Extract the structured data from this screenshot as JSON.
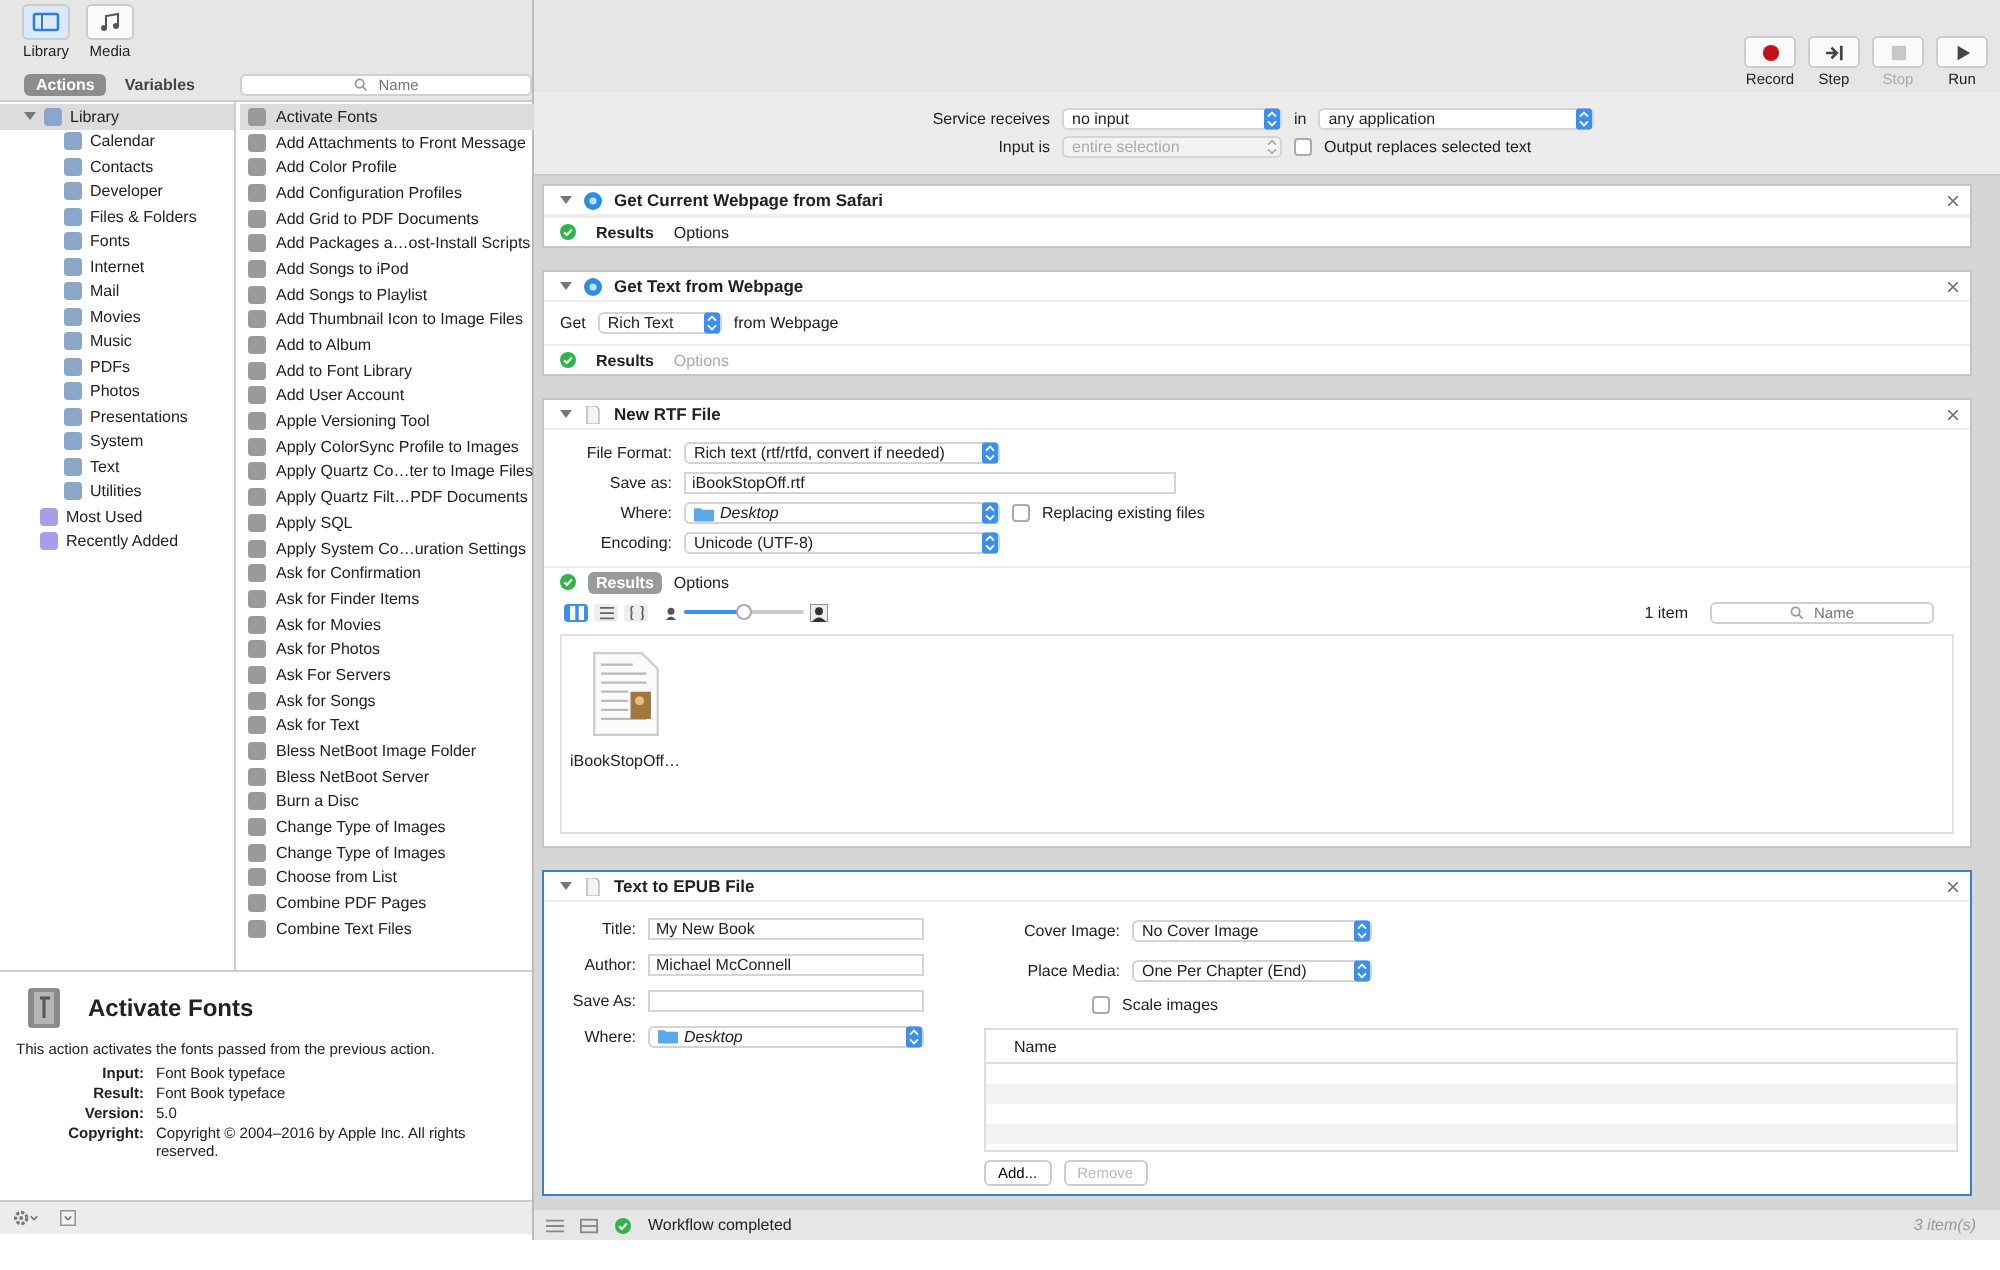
{
  "toolbar_left": [
    {
      "label": "Library",
      "kind": "library",
      "selected": true
    },
    {
      "label": "Media",
      "kind": "media",
      "selected": false
    }
  ],
  "toolbar_right": [
    {
      "label": "Record",
      "kind": "record",
      "disabled": false
    },
    {
      "label": "Step",
      "kind": "step",
      "disabled": false
    },
    {
      "label": "Stop",
      "kind": "stop",
      "disabled": true
    },
    {
      "label": "Run",
      "kind": "run",
      "disabled": false
    }
  ],
  "tabs": [
    {
      "label": "Actions",
      "selected": true
    },
    {
      "label": "Variables",
      "selected": false
    }
  ],
  "search": {
    "placeholder": "Name"
  },
  "library_tree": [
    {
      "label": "Library",
      "expanded": true,
      "selected": true,
      "children": [
        {
          "label": "Calendar",
          "selected": false
        },
        {
          "label": "Contacts",
          "selected": false
        },
        {
          "label": "Developer",
          "selected": false
        },
        {
          "label": "Files & Folders",
          "selected": false
        },
        {
          "label": "Fonts",
          "selected": false
        },
        {
          "label": "Internet",
          "selected": false
        },
        {
          "label": "Mail",
          "selected": false
        },
        {
          "label": "Movies",
          "selected": false
        },
        {
          "label": "Music",
          "selected": false
        },
        {
          "label": "PDFs",
          "selected": false
        },
        {
          "label": "Photos",
          "selected": false
        },
        {
          "label": "Presentations",
          "selected": false
        },
        {
          "label": "System",
          "selected": false
        },
        {
          "label": "Text",
          "selected": false
        },
        {
          "label": "Utilities",
          "selected": false
        }
      ]
    },
    {
      "label": "Most Used",
      "selected": false
    },
    {
      "label": "Recently Added",
      "selected": false
    }
  ],
  "action_list": [
    {
      "label": "Activate Fonts",
      "selected": true
    },
    {
      "label": "Add Attachments to Front Message",
      "selected": false
    },
    {
      "label": "Add Color Profile",
      "selected": false
    },
    {
      "label": "Add Configuration Profiles",
      "selected": false
    },
    {
      "label": "Add Grid to PDF Documents",
      "selected": false
    },
    {
      "label": "Add Packages a…ost-Install Scripts",
      "selected": false
    },
    {
      "label": "Add Songs to iPod",
      "selected": false
    },
    {
      "label": "Add Songs to Playlist",
      "selected": false
    },
    {
      "label": "Add Thumbnail Icon to Image Files",
      "selected": false
    },
    {
      "label": "Add to Album",
      "selected": false
    },
    {
      "label": "Add to Font Library",
      "selected": false
    },
    {
      "label": "Add User Account",
      "selected": false
    },
    {
      "label": "Apple Versioning Tool",
      "selected": false
    },
    {
      "label": "Apply ColorSync Profile to Images",
      "selected": false
    },
    {
      "label": "Apply Quartz Co…ter to Image Files",
      "selected": false
    },
    {
      "label": "Apply Quartz Filt…PDF Documents",
      "selected": false
    },
    {
      "label": "Apply SQL",
      "selected": false
    },
    {
      "label": "Apply System Co…uration Settings",
      "selected": false
    },
    {
      "label": "Ask for Confirmation",
      "selected": false
    },
    {
      "label": "Ask for Finder Items",
      "selected": false
    },
    {
      "label": "Ask for Movies",
      "selected": false
    },
    {
      "label": "Ask for Photos",
      "selected": false
    },
    {
      "label": "Ask For Servers",
      "selected": false
    },
    {
      "label": "Ask for Songs",
      "selected": false
    },
    {
      "label": "Ask for Text",
      "selected": false
    },
    {
      "label": "Bless NetBoot Image Folder",
      "selected": false
    },
    {
      "label": "Bless NetBoot Server",
      "selected": false
    },
    {
      "label": "Burn a Disc",
      "selected": false
    },
    {
      "label": "Change Type of Images",
      "selected": false
    },
    {
      "label": "Change Type of Images",
      "selected": false
    },
    {
      "label": "Choose from List",
      "selected": false
    },
    {
      "label": "Combine PDF Pages",
      "selected": false
    },
    {
      "label": "Combine Text Files",
      "selected": false
    }
  ],
  "info": {
    "title": "Activate Fonts",
    "description": "This action activates the fonts passed from the previous action.",
    "rows": [
      {
        "label": "Input:",
        "value": "Font Book typeface"
      },
      {
        "label": "Result:",
        "value": "Font Book typeface"
      },
      {
        "label": "Version:",
        "value": "5.0"
      },
      {
        "label": "Copyright:",
        "value": "Copyright © 2004–2016 by Apple Inc. All rights reserved."
      }
    ]
  },
  "service": {
    "receives_label": "Service receives",
    "receives": "no input",
    "in_label": "in",
    "application": "any application",
    "input_label": "Input is",
    "input": "entire selection",
    "input_disabled": true,
    "output_label": "Output replaces selected text",
    "output_checked": false
  },
  "workflow": [
    {
      "kind": "plain",
      "title": "Get Current Webpage from Safari",
      "expanded": true,
      "selected": false,
      "results": "Results",
      "results_open": false,
      "options": "Options",
      "options_enabled": true
    },
    {
      "kind": "get_text",
      "title": "Get Text from Webpage",
      "expanded": true,
      "selected": false,
      "get_label": "Get",
      "get_value": "Rich Text",
      "from_label": "from Webpage",
      "results": "Results",
      "results_open": false,
      "options": "Options",
      "options_enabled": false
    },
    {
      "kind": "rtf",
      "title": "New RTF File",
      "expanded": true,
      "selected": false,
      "fields": [
        {
          "kind": "select",
          "label": "File Format:",
          "value": "Rich text (rtf/rtfd, convert if needed)"
        },
        {
          "kind": "text",
          "label": "Save as:",
          "value": "iBookStopOff.rtf"
        },
        {
          "kind": "folder",
          "label": "Where:",
          "value": "Desktop",
          "checkbox": "Replacing existing files",
          "checked": false
        },
        {
          "kind": "select",
          "label": "Encoding:",
          "value": "Unicode (UTF-8)"
        }
      ],
      "results": "Results",
      "results_open": true,
      "options": "Options",
      "options_enabled": true,
      "view_modes": [
        {
          "kind": "icons",
          "selected": true
        },
        {
          "kind": "list",
          "selected": false
        },
        {
          "kind": "columns",
          "selected": false
        }
      ],
      "slider": {
        "level": 0.5
      },
      "count": "1 item",
      "search_placeholder": "Name",
      "files": [
        {
          "name": "iBookStopOff…"
        }
      ]
    },
    {
      "kind": "epub",
      "title": "Text to EPUB File",
      "expanded": true,
      "selected": true,
      "fields": [
        {
          "kind": "text",
          "label": "Title:",
          "value": "My New Book"
        },
        {
          "kind": "text",
          "label": "Author:",
          "value": "Michael McConnell"
        },
        {
          "kind": "text",
          "label": "Save As:"
        },
        {
          "kind": "folder",
          "label": "Where:",
          "value": "Desktop"
        }
      ],
      "right_fields": [
        {
          "kind": "select",
          "label": "Cover Image:",
          "value": "No Cover Image"
        },
        {
          "kind": "select",
          "label": "Place Media:",
          "value": "One Per Chapter (End)"
        }
      ],
      "checkbox": {
        "label": "Scale images",
        "checked": false
      },
      "table_column": "Name",
      "add_button": "Add...",
      "remove_button": "Remove",
      "remove_disabled": true
    }
  ],
  "status": {
    "message": "Workflow completed",
    "count": "3 item(s)"
  }
}
